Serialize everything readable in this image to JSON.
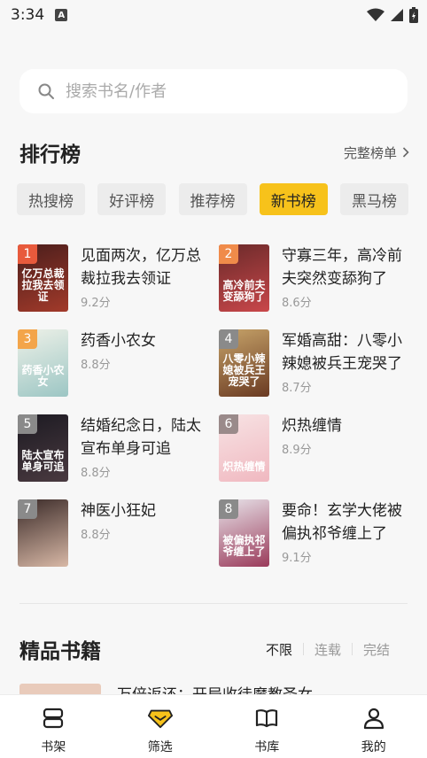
{
  "status": {
    "time": "3:34",
    "notification_icon": "A"
  },
  "search": {
    "placeholder": "搜索书名/作者"
  },
  "ranking": {
    "title": "排行榜",
    "full_list": "完整榜单",
    "tabs": [
      {
        "label": "热搜榜",
        "active": false
      },
      {
        "label": "好评榜",
        "active": false
      },
      {
        "label": "推荐榜",
        "active": false
      },
      {
        "label": "新书榜",
        "active": true
      },
      {
        "label": "黑马榜",
        "active": false
      }
    ],
    "books": [
      {
        "rank": "1",
        "title": "见面两次，亿万总裁拉我去领证",
        "score": "9.2分",
        "cover_text": "亿万总裁拉我去领证",
        "colors": [
          "#4a1e1c",
          "#a23a2a"
        ],
        "badge": "#e85a3c"
      },
      {
        "rank": "2",
        "title": "守寡三年，高冷前夫突然变舔狗了",
        "score": "8.6分",
        "cover_text": "高冷前夫变舔狗了",
        "colors": [
          "#6a2a2a",
          "#c9474a"
        ],
        "badge": "#f08b4a"
      },
      {
        "rank": "3",
        "title": "药香小农女",
        "score": "8.8分",
        "cover_text": "药香小农女",
        "colors": [
          "#eef1e8",
          "#9cc6c4"
        ],
        "badge": "#f3a54a"
      },
      {
        "rank": "4",
        "title": "军婚高甜：八零小辣媳被兵王宠哭了",
        "score": "8.7分",
        "cover_text": "八零小辣媳被兵王宠哭了",
        "colors": [
          "#c7a46a",
          "#6a3a22"
        ],
        "badge": "#8a8a8a"
      },
      {
        "rank": "5",
        "title": "结婚纪念日，陆太宣布单身可追",
        "score": "8.8分",
        "cover_text": "陆太宣布单身可追",
        "colors": [
          "#1c1a22",
          "#4a3a40"
        ],
        "badge": "#8a8a8a"
      },
      {
        "rank": "6",
        "title": "炽热缠情",
        "score": "8.9分",
        "cover_text": "炽热缠情",
        "colors": [
          "#f7e3e4",
          "#f0b8c0"
        ],
        "badge": "#9a8a8a"
      },
      {
        "rank": "7",
        "title": "神医小狂妃",
        "score": "8.8分",
        "cover_text": "",
        "colors": [
          "#3a2a28",
          "#d8b8a6"
        ],
        "badge": "#8a8a8a"
      },
      {
        "rank": "8",
        "title": "要命！玄学大佬被偏执祁爷缠上了",
        "score": "9.1分",
        "cover_text": "被偏执祁爷缠上了",
        "colors": [
          "#e8e4ea",
          "#9a3a5a"
        ],
        "badge": "#8a8a8a"
      }
    ]
  },
  "quality": {
    "title": "精品书籍",
    "filters": [
      "不限",
      "连载",
      "完结"
    ],
    "active_filter": 0,
    "peek_title": "万倍返还：开局收徒魔教圣女"
  },
  "nav": [
    {
      "label": "书架",
      "icon": "bookshelf-icon"
    },
    {
      "label": "筛选",
      "icon": "filter-diamond-icon"
    },
    {
      "label": "书库",
      "icon": "open-book-icon"
    },
    {
      "label": "我的",
      "icon": "user-icon"
    }
  ]
}
